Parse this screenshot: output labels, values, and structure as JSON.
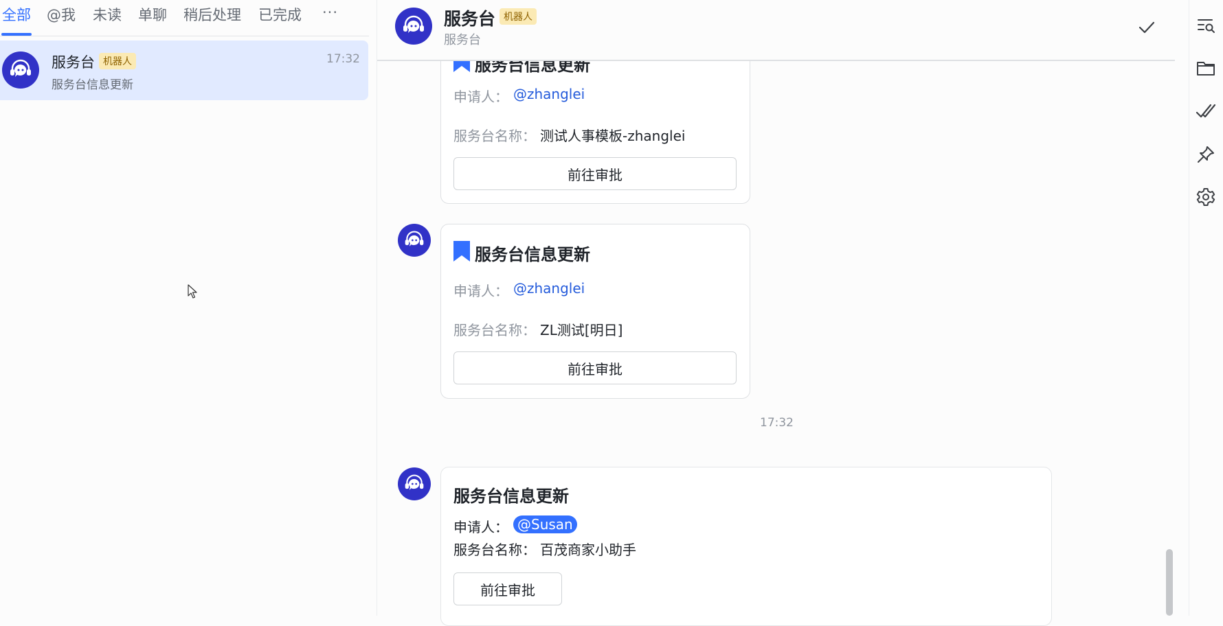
{
  "tabs": [
    {
      "label": "全部",
      "active": true
    },
    {
      "label": "@我"
    },
    {
      "label": "未读"
    },
    {
      "label": "单聊"
    },
    {
      "label": "稍后处理"
    },
    {
      "label": "已完成"
    },
    {
      "label": "···"
    }
  ],
  "conversation": {
    "name": "服务台",
    "badge": "机器人",
    "time": "17:32",
    "preview": "服务台信息更新"
  },
  "header": {
    "title": "服务台",
    "badge": "机器人",
    "subtitle": "服务台"
  },
  "messages": [
    {
      "title": "服务台信息更新",
      "applicant_label": "申请人：",
      "applicant": "@zhanglei",
      "desk_label": "服务台名称：",
      "desk_name": "测试人事模板-zhanglei",
      "button": "前往审批"
    },
    {
      "title": "服务台信息更新",
      "applicant_label": "申请人：",
      "applicant": "@zhanglei",
      "desk_label": "服务台名称：",
      "desk_name": "ZL测试[明日]",
      "button": "前往审批"
    },
    {
      "title": "服务台信息更新",
      "applicant_label": "申请人：",
      "applicant": "@Susan",
      "desk_label": "服务台名称：",
      "desk_name": "百茂商家小助手",
      "button": "前往审批"
    }
  ],
  "time_separator": "17:32",
  "colors": {
    "accent": "#3370ff",
    "avatar": "#3132c7",
    "badge_bg": "#fbeab4",
    "selected_bg": "#e1eaff"
  },
  "toolbar_icons": [
    "search-history-icon",
    "folder-icon",
    "double-check-icon",
    "pin-icon",
    "settings-icon"
  ]
}
